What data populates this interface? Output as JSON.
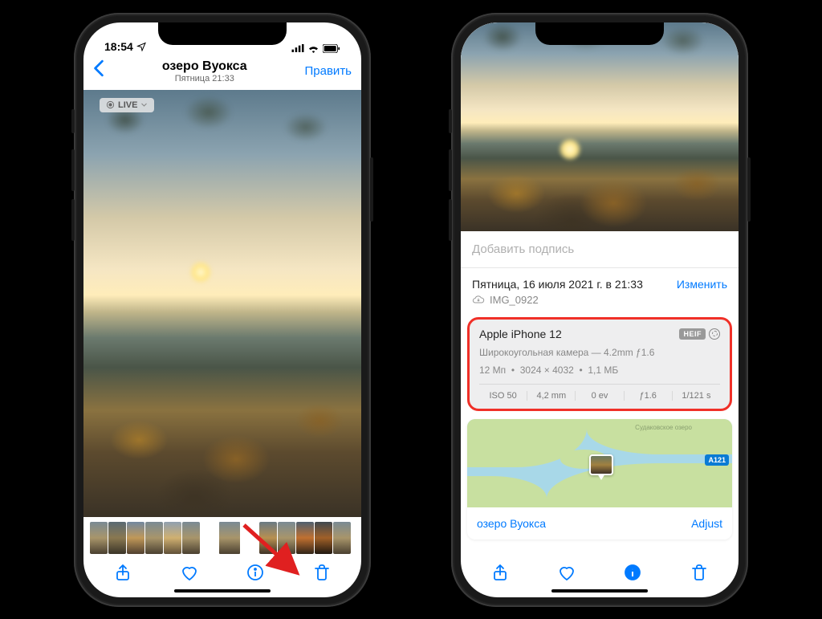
{
  "status": {
    "time": "18:54",
    "signal": "▪▪▪▪",
    "wifi": "wifi",
    "battery": "100"
  },
  "left": {
    "title": "озеро Вуокса",
    "subtitle": "Пятница 21:33",
    "edit": "Править",
    "live": "LIVE"
  },
  "right": {
    "caption_placeholder": "Добавить подпись",
    "datetime": "Пятница, 16 июля 2021 г. в 21:33",
    "change": "Изменить",
    "filename": "IMG_0922",
    "exif": {
      "device": "Apple iPhone 12",
      "format": "HEIF",
      "lens": "Широкоугольная камера — 4.2mm ƒ1.6",
      "mp": "12 Мп",
      "dimensions": "3024 × 4032",
      "size": "1,1 МБ",
      "iso": "ISO 50",
      "focal": "4,2 mm",
      "ev": "0 ev",
      "aperture": "ƒ1.6",
      "shutter": "1/121 s"
    },
    "map": {
      "label1": "Судаковское озеро",
      "road": "А121",
      "location": "озеро Вуокса",
      "adjust": "Adjust"
    }
  }
}
